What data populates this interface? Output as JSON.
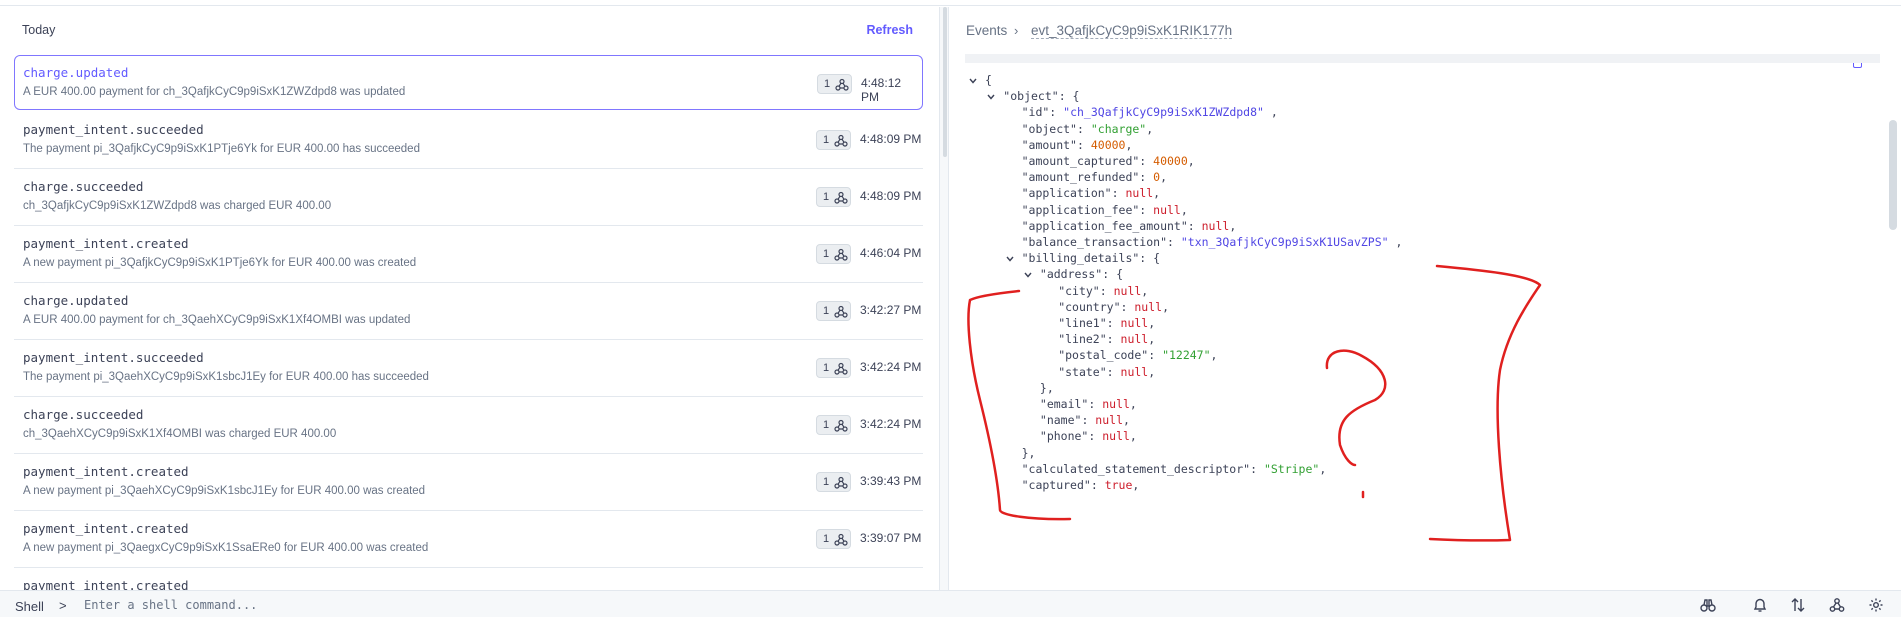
{
  "left": {
    "title": "Today",
    "refresh_label": "Refresh",
    "events": [
      {
        "type": "charge.updated",
        "desc": "A EUR 400.00 payment for ch_3QafjkCyC9p9iSxK1ZWZdpd8 was updated",
        "count": "1",
        "time": "4:48:12 PM",
        "selected": true
      },
      {
        "type": "payment_intent.succeeded",
        "desc": "The payment pi_3QafjkCyC9p9iSxK1PTje6Yk for EUR 400.00 has succeeded",
        "count": "1",
        "time": "4:48:09 PM"
      },
      {
        "type": "charge.succeeded",
        "desc": "ch_3QafjkCyC9p9iSxK1ZWZdpd8 was charged EUR 400.00",
        "count": "1",
        "time": "4:48:09 PM"
      },
      {
        "type": "payment_intent.created",
        "desc": "A new payment pi_3QafjkCyC9p9iSxK1PTje6Yk for EUR 400.00 was created",
        "count": "1",
        "time": "4:46:04 PM"
      },
      {
        "type": "charge.updated",
        "desc": "A EUR 400.00 payment for ch_3QaehXCyC9p9iSxK1Xf4OMBI was updated",
        "count": "1",
        "time": "3:42:27 PM"
      },
      {
        "type": "payment_intent.succeeded",
        "desc": "The payment pi_3QaehXCyC9p9iSxK1sbcJ1Ey for EUR 400.00 has succeeded",
        "count": "1",
        "time": "3:42:24 PM"
      },
      {
        "type": "charge.succeeded",
        "desc": "ch_3QaehXCyC9p9iSxK1Xf4OMBI was charged EUR 400.00",
        "count": "1",
        "time": "3:42:24 PM"
      },
      {
        "type": "payment_intent.created",
        "desc": "A new payment pi_3QaehXCyC9p9iSxK1sbcJ1Ey for EUR 400.00 was created",
        "count": "1",
        "time": "3:39:43 PM"
      },
      {
        "type": "payment_intent.created",
        "desc": "A new payment pi_3QaegxCyC9p9iSxK1SsaERe0 for EUR 400.00 was created",
        "count": "1",
        "time": "3:39:07 PM"
      },
      {
        "type": "payment_intent.created",
        "desc": "",
        "count": "",
        "time": ""
      }
    ]
  },
  "right": {
    "breadcrumb_root": "Events",
    "breadcrumb_sep": "›",
    "breadcrumb_id": "evt_3QafjkCyC9p9iSxK1RIK177h"
  },
  "json_view": {
    "lines": [
      {
        "indent": 0,
        "chevron": true,
        "key": "",
        "open": "{",
        "tail": ""
      },
      {
        "indent": 1,
        "chevron": true,
        "key": "\"object\"",
        "open": "{",
        "tail": ""
      },
      {
        "indent": 2,
        "key": "\"id\"",
        "value": "\"ch_3QafjkCyC9p9iSxK1ZWZdpd8\"",
        "vtype": "id",
        "tail": " ,"
      },
      {
        "indent": 2,
        "key": "\"object\"",
        "value": "\"charge\"",
        "vtype": "s",
        "tail": ","
      },
      {
        "indent": 2,
        "key": "\"amount\"",
        "value": "40000",
        "vtype": "n",
        "tail": ","
      },
      {
        "indent": 2,
        "key": "\"amount_captured\"",
        "value": "40000",
        "vtype": "n",
        "tail": ","
      },
      {
        "indent": 2,
        "key": "\"amount_refunded\"",
        "value": "0",
        "vtype": "n",
        "tail": ","
      },
      {
        "indent": 2,
        "key": "\"application\"",
        "value": "null",
        "vtype": "nl",
        "tail": ","
      },
      {
        "indent": 2,
        "key": "\"application_fee\"",
        "value": "null",
        "vtype": "nl",
        "tail": ","
      },
      {
        "indent": 2,
        "key": "\"application_fee_amount\"",
        "value": "null",
        "vtype": "nl",
        "tail": ","
      },
      {
        "indent": 2,
        "key": "\"balance_transaction\"",
        "value": "\"txn_3QafjkCyC9p9iSxK1USavZPS\"",
        "vtype": "id",
        "tail": " ,"
      },
      {
        "indent": 2,
        "chevron": true,
        "key": "\"billing_details\"",
        "open": "{",
        "tail": ""
      },
      {
        "indent": 3,
        "chevron": true,
        "key": "\"address\"",
        "open": "{",
        "tail": ""
      },
      {
        "indent": 4,
        "key": "\"city\"",
        "value": "null",
        "vtype": "nl",
        "tail": ","
      },
      {
        "indent": 4,
        "key": "\"country\"",
        "value": "null",
        "vtype": "nl",
        "tail": ","
      },
      {
        "indent": 4,
        "key": "\"line1\"",
        "value": "null",
        "vtype": "nl",
        "tail": ","
      },
      {
        "indent": 4,
        "key": "\"line2\"",
        "value": "null",
        "vtype": "nl",
        "tail": ","
      },
      {
        "indent": 4,
        "key": "\"postal_code\"",
        "value": "\"12247\"",
        "vtype": "s",
        "tail": ","
      },
      {
        "indent": 4,
        "key": "\"state\"",
        "value": "null",
        "vtype": "nl",
        "tail": ","
      },
      {
        "indent": 3,
        "close": "},"
      },
      {
        "indent": 3,
        "key": "\"email\"",
        "value": "null",
        "vtype": "nl",
        "tail": ","
      },
      {
        "indent": 3,
        "key": "\"name\"",
        "value": "null",
        "vtype": "nl",
        "tail": ","
      },
      {
        "indent": 3,
        "key": "\"phone\"",
        "value": "null",
        "vtype": "nl",
        "tail": ","
      },
      {
        "indent": 2,
        "close": "},"
      },
      {
        "indent": 2,
        "key": "\"calculated_statement_descriptor\"",
        "value": "\"Stripe\"",
        "vtype": "s",
        "tail": ","
      },
      {
        "indent": 2,
        "key": "\"captured\"",
        "value": "true",
        "vtype": "nl",
        "tail": ","
      }
    ]
  },
  "shell": {
    "label": "Shell",
    "gt": ">",
    "placeholder": "Enter a shell command..."
  },
  "toolbar_icons": [
    "binoculars-icon",
    "bell-icon",
    "sort-icon",
    "webhook-icon",
    "settings-icon"
  ],
  "colors": {
    "accent": "#635bff",
    "annotation": "#e0201f"
  }
}
